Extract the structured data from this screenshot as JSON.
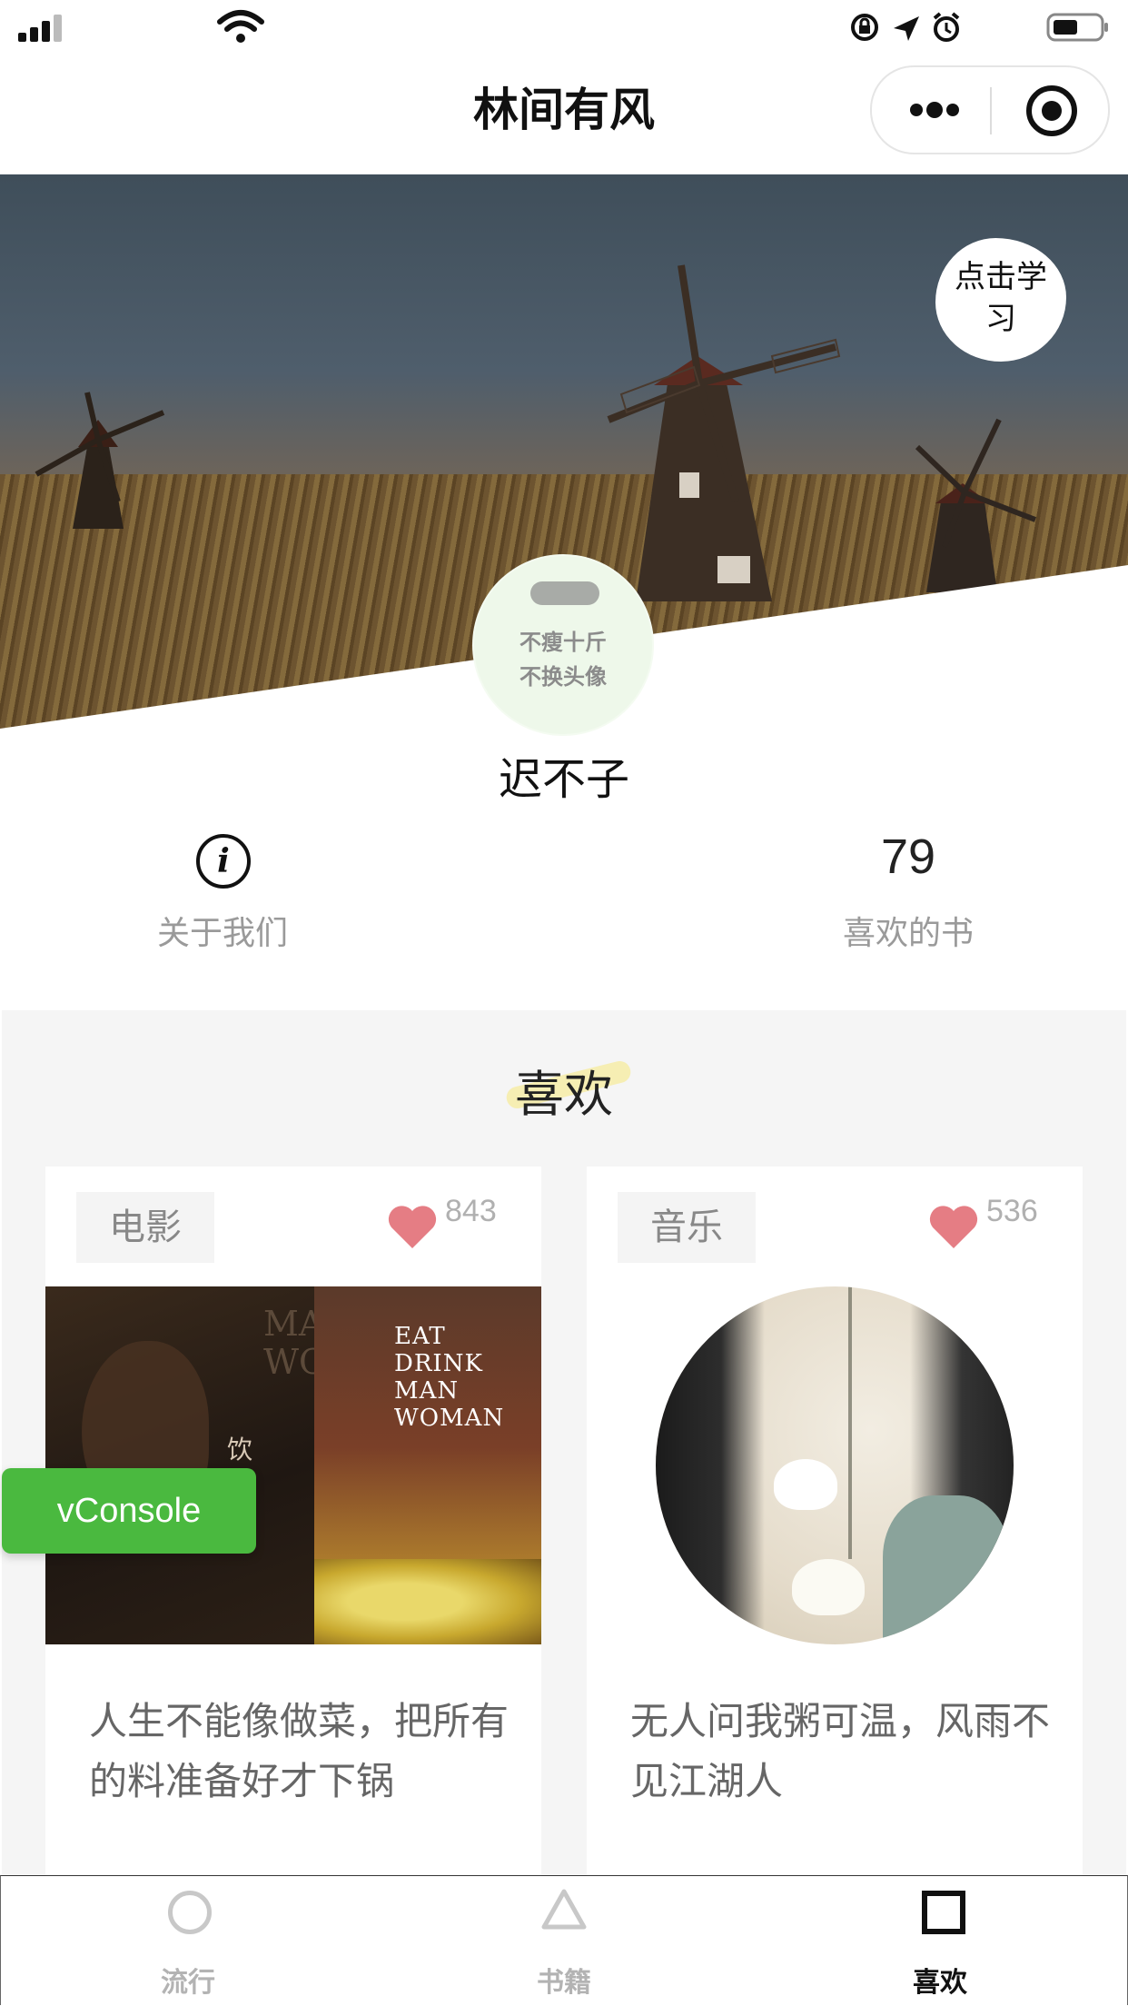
{
  "nav": {
    "title": "林间有风"
  },
  "banner": {
    "tap_learn": "点击学习"
  },
  "profile": {
    "avatar_text": [
      "不瘦十斤",
      "不换头像"
    ],
    "nickname": "迟不子",
    "about_label": "关于我们",
    "likes_count": "79",
    "likes_label": "喜欢的书"
  },
  "section": {
    "title": "喜欢"
  },
  "cards": [
    {
      "tag": "电影",
      "count": "843",
      "desc": "人生不能像做菜，把所有的料准备好才下锅",
      "poster_text_left": "MAN WOMA",
      "poster_text_right": "EAT DRINK MAN WOMAN",
      "poster_chars": "饮食"
    },
    {
      "tag": "音乐",
      "count": "536",
      "desc": "无人问我粥可温，风雨不见江湖人"
    }
  ],
  "vconsole": {
    "label": "vConsole"
  },
  "tabs": [
    {
      "label": "流行",
      "icon": "circle-icon"
    },
    {
      "label": "书籍",
      "icon": "triangle-icon"
    },
    {
      "label": "喜欢",
      "icon": "square-icon",
      "active": true
    }
  ],
  "colors": {
    "heart": "#e57d84",
    "vconsole": "#4ab93f",
    "section_bg": "#f5f5f5"
  }
}
